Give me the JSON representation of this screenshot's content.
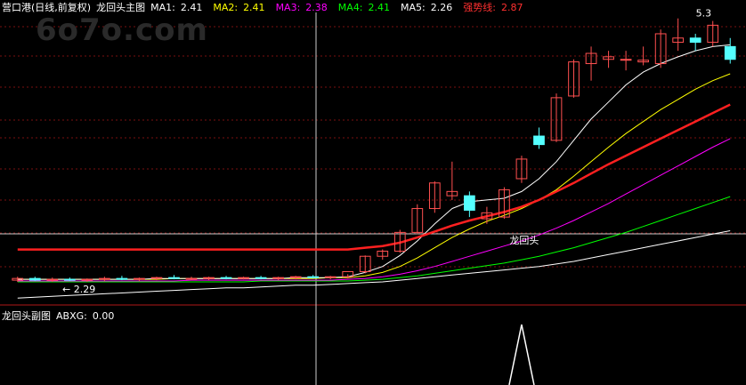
{
  "header": {
    "stock": "营口港(日线,前复权)",
    "main_title": "龙回头主图",
    "ma1_label": "MA1:",
    "ma1_value": "2.41",
    "ma2_label": "MA2:",
    "ma2_value": "2.41",
    "ma3_label": "MA3:",
    "ma3_value": "2.38",
    "ma4_label": "MA4:",
    "ma4_value": "2.41",
    "ma5_label": "MA5:",
    "ma5_value": "2.26",
    "strong_label": "强势线:",
    "strong_value": "2.87"
  },
  "watermark": "6o7o.com",
  "sub_header": {
    "title": "龙回头副图",
    "abxg_label": "ABXG:",
    "abxg_value": "0.00"
  },
  "colors": {
    "up": "#ff5050",
    "down": "#54ffff",
    "ma1": "#ffffff",
    "ma2": "#ffff00",
    "ma3": "#ff00ff",
    "ma4": "#00ff00",
    "ma5": "#ffffff",
    "strong": "#ff2020",
    "header_text": "#ffffff"
  },
  "chart_data": {
    "type": "candlestick",
    "price_range": [
      2.0,
      5.4
    ],
    "candles": [
      {
        "o": 2.26,
        "h": 2.3,
        "l": 2.24,
        "c": 2.28
      },
      {
        "o": 2.28,
        "h": 2.3,
        "l": 2.25,
        "c": 2.26
      },
      {
        "o": 2.26,
        "h": 2.29,
        "l": 2.24,
        "c": 2.27
      },
      {
        "o": 2.27,
        "h": 2.29,
        "l": 2.25,
        "c": 2.26
      },
      {
        "o": 2.26,
        "h": 2.28,
        "l": 2.24,
        "c": 2.27
      },
      {
        "o": 2.27,
        "h": 2.3,
        "l": 2.25,
        "c": 2.28
      },
      {
        "o": 2.28,
        "h": 2.31,
        "l": 2.26,
        "c": 2.27
      },
      {
        "o": 2.27,
        "h": 2.29,
        "l": 2.25,
        "c": 2.28
      },
      {
        "o": 2.28,
        "h": 2.3,
        "l": 2.26,
        "c": 2.29
      },
      {
        "o": 2.29,
        "h": 2.32,
        "l": 2.27,
        "c": 2.28
      },
      {
        "o": 2.28,
        "h": 2.3,
        "l": 2.26,
        "c": 2.28
      },
      {
        "o": 2.28,
        "h": 2.3,
        "l": 2.26,
        "c": 2.29
      },
      {
        "o": 2.29,
        "h": 2.31,
        "l": 2.27,
        "c": 2.28
      },
      {
        "o": 2.28,
        "h": 2.3,
        "l": 2.27,
        "c": 2.29
      },
      {
        "o": 2.29,
        "h": 2.31,
        "l": 2.27,
        "c": 2.28
      },
      {
        "o": 2.28,
        "h": 2.3,
        "l": 2.26,
        "c": 2.29
      },
      {
        "o": 2.29,
        "h": 2.31,
        "l": 2.27,
        "c": 2.3
      },
      {
        "o": 2.3,
        "h": 2.32,
        "l": 2.28,
        "c": 2.29
      },
      {
        "o": 2.29,
        "h": 2.31,
        "l": 2.27,
        "c": 2.3
      },
      {
        "o": 2.3,
        "h": 2.33,
        "l": 2.28,
        "c": 2.36
      },
      {
        "o": 2.36,
        "h": 2.55,
        "l": 2.34,
        "c": 2.54
      },
      {
        "o": 2.54,
        "h": 2.62,
        "l": 2.5,
        "c": 2.6
      },
      {
        "o": 2.6,
        "h": 2.85,
        "l": 2.58,
        "c": 2.82
      },
      {
        "o": 2.82,
        "h": 3.15,
        "l": 2.8,
        "c": 3.1
      },
      {
        "o": 3.1,
        "h": 3.42,
        "l": 3.05,
        "c": 3.4
      },
      {
        "o": 3.25,
        "h": 3.65,
        "l": 3.2,
        "c": 3.3
      },
      {
        "o": 3.25,
        "h": 3.3,
        "l": 3.0,
        "c": 3.08
      },
      {
        "o": 2.98,
        "h": 3.12,
        "l": 2.92,
        "c": 3.05
      },
      {
        "o": 3.0,
        "h": 3.35,
        "l": 2.98,
        "c": 3.32
      },
      {
        "o": 3.45,
        "h": 3.72,
        "l": 3.4,
        "c": 3.68
      },
      {
        "o": 3.95,
        "h": 4.05,
        "l": 3.8,
        "c": 3.85
      },
      {
        "o": 3.9,
        "h": 4.45,
        "l": 3.88,
        "c": 4.4
      },
      {
        "o": 4.42,
        "h": 4.85,
        "l": 4.4,
        "c": 4.82
      },
      {
        "o": 4.8,
        "h": 5.0,
        "l": 4.6,
        "c": 4.92
      },
      {
        "o": 4.85,
        "h": 4.95,
        "l": 4.75,
        "c": 4.88
      },
      {
        "o": 4.85,
        "h": 4.95,
        "l": 4.72,
        "c": 4.85
      },
      {
        "o": 4.82,
        "h": 5.0,
        "l": 4.78,
        "c": 4.84
      },
      {
        "o": 4.8,
        "h": 5.2,
        "l": 4.75,
        "c": 5.15
      },
      {
        "o": 5.05,
        "h": 5.33,
        "l": 4.95,
        "c": 5.1
      },
      {
        "o": 5.1,
        "h": 5.15,
        "l": 4.95,
        "c": 5.05
      },
      {
        "o": 5.05,
        "h": 5.3,
        "l": 5.0,
        "c": 5.25
      },
      {
        "o": 5.0,
        "h": 5.1,
        "l": 4.8,
        "c": 4.85
      }
    ],
    "ma1": [
      2.27,
      2.27,
      2.27,
      2.27,
      2.27,
      2.27,
      2.27,
      2.27,
      2.28,
      2.28,
      2.28,
      2.28,
      2.28,
      2.28,
      2.28,
      2.28,
      2.29,
      2.29,
      2.29,
      2.3,
      2.35,
      2.42,
      2.55,
      2.72,
      2.92,
      3.1,
      3.18,
      3.2,
      3.22,
      3.3,
      3.45,
      3.65,
      3.9,
      4.15,
      4.35,
      4.55,
      4.7,
      4.8,
      4.88,
      4.95,
      5.0,
      5.02
    ],
    "ma2": [
      2.27,
      2.27,
      2.27,
      2.27,
      2.27,
      2.27,
      2.27,
      2.27,
      2.27,
      2.28,
      2.28,
      2.28,
      2.28,
      2.28,
      2.28,
      2.28,
      2.28,
      2.28,
      2.29,
      2.29,
      2.31,
      2.35,
      2.42,
      2.52,
      2.64,
      2.76,
      2.86,
      2.95,
      3.02,
      3.1,
      3.2,
      3.32,
      3.48,
      3.65,
      3.82,
      3.98,
      4.12,
      4.26,
      4.38,
      4.5,
      4.6,
      4.68
    ],
    "ma3": [
      2.25,
      2.25,
      2.25,
      2.25,
      2.25,
      2.25,
      2.25,
      2.25,
      2.25,
      2.25,
      2.26,
      2.26,
      2.26,
      2.26,
      2.26,
      2.26,
      2.26,
      2.26,
      2.26,
      2.27,
      2.28,
      2.3,
      2.33,
      2.37,
      2.42,
      2.48,
      2.54,
      2.6,
      2.66,
      2.72,
      2.79,
      2.87,
      2.96,
      3.06,
      3.16,
      3.27,
      3.38,
      3.49,
      3.6,
      3.71,
      3.82,
      3.92
    ],
    "ma4": [
      2.24,
      2.24,
      2.24,
      2.24,
      2.24,
      2.24,
      2.24,
      2.24,
      2.24,
      2.24,
      2.24,
      2.24,
      2.24,
      2.24,
      2.25,
      2.25,
      2.25,
      2.25,
      2.25,
      2.25,
      2.26,
      2.27,
      2.29,
      2.31,
      2.34,
      2.37,
      2.4,
      2.43,
      2.46,
      2.5,
      2.54,
      2.59,
      2.64,
      2.7,
      2.76,
      2.82,
      2.89,
      2.96,
      3.03,
      3.1,
      3.17,
      3.24
    ],
    "ma5": [
      2.05,
      2.06,
      2.07,
      2.08,
      2.09,
      2.1,
      2.11,
      2.12,
      2.13,
      2.14,
      2.15,
      2.16,
      2.17,
      2.17,
      2.18,
      2.19,
      2.2,
      2.2,
      2.21,
      2.22,
      2.23,
      2.24,
      2.26,
      2.28,
      2.3,
      2.32,
      2.34,
      2.36,
      2.38,
      2.4,
      2.42,
      2.45,
      2.48,
      2.52,
      2.56,
      2.6,
      2.64,
      2.68,
      2.72,
      2.76,
      2.8,
      2.84
    ],
    "strong": [
      2.62,
      2.62,
      2.62,
      2.62,
      2.62,
      2.62,
      2.62,
      2.62,
      2.62,
      2.62,
      2.62,
      2.62,
      2.62,
      2.62,
      2.62,
      2.62,
      2.62,
      2.62,
      2.62,
      2.62,
      2.64,
      2.66,
      2.7,
      2.76,
      2.83,
      2.9,
      2.96,
      3.01,
      3.06,
      3.12,
      3.2,
      3.3,
      3.4,
      3.51,
      3.62,
      3.72,
      3.82,
      3.92,
      4.02,
      4.12,
      4.22,
      4.32
    ],
    "annotations": [
      {
        "text": "2.29",
        "candle": 0
      },
      {
        "text": "5.3",
        "candle": 38
      },
      {
        "text": "龙回头",
        "candle": 28
      }
    ],
    "abxg_peak_candle": 29,
    "abxg_peak_value": 1
  }
}
